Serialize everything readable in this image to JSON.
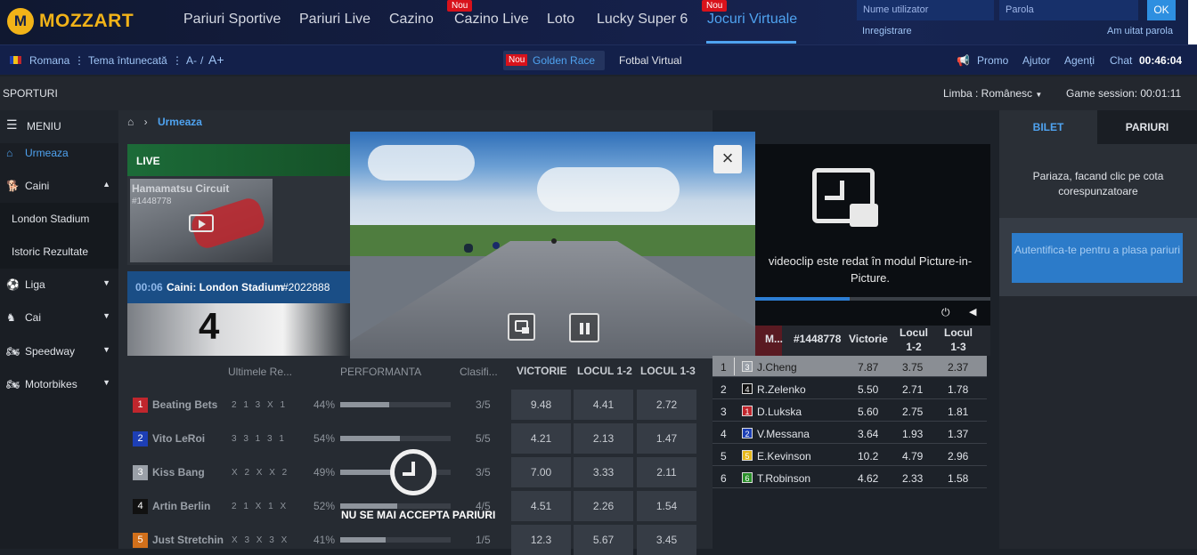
{
  "brand": {
    "logo_letter": "M",
    "name": "MOZZART"
  },
  "nav": {
    "items": [
      {
        "label": "Pariuri Sportive"
      },
      {
        "label": "Pariuri Live"
      },
      {
        "label": "Cazino"
      },
      {
        "label": "Cazino Live",
        "badge": "Nou"
      },
      {
        "label": "Loto"
      },
      {
        "label": "Lucky Super 6"
      },
      {
        "label": "Jocuri Virtuale",
        "badge": "Nou",
        "active": true
      }
    ]
  },
  "login": {
    "username_placeholder": "Nume utilizator",
    "password_placeholder": "Parola",
    "ok_label": "OK",
    "register_label": "Inregistrare",
    "forgot_label": "Am uitat parola"
  },
  "subbar": {
    "language": "Romana",
    "theme": "Tema întunecată",
    "font_minus": "A-",
    "font_sep": "/",
    "font_plus": "A+",
    "golden_badge": "Nou",
    "golden_label": "Golden Race",
    "fotbal_label": "Fotbal Virtual",
    "promo": "Promo",
    "help": "Ajutor",
    "agents": "Agenți",
    "chat": "Chat",
    "clock": "00:46:04"
  },
  "bar3": {
    "sports_label": "SPORTURI",
    "language_select": "Limba : Românesc",
    "session": "Game session: 00:01:11"
  },
  "sidebar": {
    "menu_label": "MENIU",
    "items": [
      {
        "label": "Urmeaza"
      },
      {
        "label": "Caini"
      },
      {
        "label": "London Stadium"
      },
      {
        "label": "Istoric Rezultate"
      },
      {
        "label": "Liga"
      },
      {
        "label": "Cai"
      },
      {
        "label": "Speedway"
      },
      {
        "label": "Motorbikes"
      }
    ]
  },
  "breadcrumb": {
    "current": "Urmeaza"
  },
  "live_card": {
    "live_label": "LIVE",
    "title": "Hamamatsu Circuit",
    "id": "#1448778"
  },
  "next_card": {
    "time": "00:06",
    "title": "Caini: London Stadium",
    "id": "#2022888"
  },
  "runners_table": {
    "headers": {
      "last": "Ultimele Re...",
      "performance": "PERFORMANTA",
      "rank": "Clasifi...",
      "win": "VICTORIE",
      "place12": "LOCUL 1-2",
      "place13": "LOCUL 1-3"
    },
    "rows": [
      {
        "num": "1",
        "color": "#c0262d",
        "name": "Beating Bets",
        "results": "2 1 3 X 1",
        "pct": "44%",
        "perf": 0.44,
        "rank": "3/5",
        "win": "9.48",
        "p12": "4.41",
        "p13": "2.72"
      },
      {
        "num": "2",
        "color": "#1d3fb5",
        "name": "Vito LeRoi",
        "results": "3 3 1 3 1",
        "pct": "54%",
        "perf": 0.54,
        "rank": "5/5",
        "win": "4.21",
        "p12": "2.13",
        "p13": "1.47"
      },
      {
        "num": "3",
        "color": "#9aa0a8",
        "name": "Kiss Bang",
        "results": "X 2 X X 2",
        "pct": "49%",
        "perf": 0.49,
        "rank": "3/5",
        "win": "7.00",
        "p12": "3.33",
        "p13": "2.11"
      },
      {
        "num": "4",
        "color": "#111111",
        "name": "Artin Berlin",
        "results": "2 1 X 1 X",
        "pct": "52%",
        "perf": 0.52,
        "rank": "4/5",
        "win": "4.51",
        "p12": "2.26",
        "p13": "1.54"
      },
      {
        "num": "5",
        "color": "#d2701b",
        "name": "Just Stretchin",
        "results": "X 3 X 3 X",
        "pct": "41%",
        "perf": 0.41,
        "rank": "1/5",
        "win": "12.3",
        "p12": "5.67",
        "p13": "3.45"
      }
    ],
    "closed_notice": "NU SE MAI ACCEPTA PARIURI"
  },
  "video_popup": {
    "close_icon": "close-icon",
    "pip_icon": "picture-in-picture-icon",
    "pause_icon": "pause-icon"
  },
  "pip_panel": {
    "message": "videoclip este redat în modul Picture-in-Picture.",
    "progress": 0.4
  },
  "race_table": {
    "headers": {
      "m": "M...",
      "id": "#1448778",
      "win": "Victorie",
      "p12": "Locul 1-2",
      "p13": "Locul 1-3"
    },
    "rows": [
      {
        "pos": "1",
        "num": "3",
        "color": "#9aa0a8",
        "name": "J.Cheng",
        "win": "7.87",
        "p12": "3.75",
        "p13": "2.37",
        "highlight": true
      },
      {
        "pos": "2",
        "num": "4",
        "color": "#111111",
        "name": "R.Zelenko",
        "win": "5.50",
        "p12": "2.71",
        "p13": "1.78"
      },
      {
        "pos": "3",
        "num": "1",
        "color": "#c0262d",
        "name": "D.Lukska",
        "win": "5.60",
        "p12": "2.75",
        "p13": "1.81"
      },
      {
        "pos": "4",
        "num": "2",
        "color": "#1d3fb5",
        "name": "V.Messana",
        "win": "3.64",
        "p12": "1.93",
        "p13": "1.37"
      },
      {
        "pos": "5",
        "num": "5",
        "color": "#e8b81a",
        "name": "E.Kevinson",
        "win": "10.2",
        "p12": "4.79",
        "p13": "2.96"
      },
      {
        "pos": "6",
        "num": "6",
        "color": "#2a8f2a",
        "name": "T.Robinson",
        "win": "4.62",
        "p12": "2.33",
        "p13": "1.58"
      }
    ]
  },
  "betslip": {
    "tab_ticket": "BILET",
    "tab_bets": "PARIURI",
    "hint": "Pariaza, facand clic pe cota corespunzatoare",
    "auth_button": "Autentifica-te pentru a plasa pariuri"
  }
}
